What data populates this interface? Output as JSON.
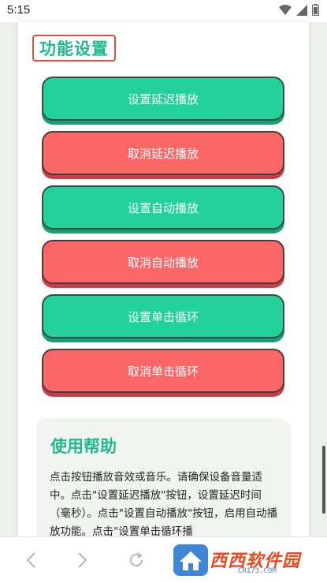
{
  "status_bar": {
    "time": "5:15",
    "icons": [
      "wifi-icon",
      "signal-icon",
      "battery-icon"
    ]
  },
  "settings": {
    "title": "功能设置",
    "buttons": [
      {
        "label": "设置延迟播放",
        "color": "#22d29a"
      },
      {
        "label": "取消延迟播放",
        "color": "#fb6767"
      },
      {
        "label": "设置自动播放",
        "color": "#22d29a"
      },
      {
        "label": "取消自动播放",
        "color": "#fb6767"
      },
      {
        "label": "设置单击循环",
        "color": "#22d29a"
      },
      {
        "label": "取消单击循环",
        "color": "#fb6767"
      }
    ]
  },
  "help": {
    "title": "使用帮助",
    "text": "点击按钮播放音效或音乐。请确保设备音量适中。点击\"设置延迟播放\"按钮，设置延迟时间（毫秒）。点击\"设置自动播放\"按钮，启用自动播放功能。点击\"设置单击循环播"
  },
  "nav": {
    "icons": [
      "back-icon",
      "forward-icon",
      "refresh-icon"
    ]
  },
  "watermark": {
    "text": "西西软件园",
    "sub": "CR173.COM"
  },
  "colors": {
    "accent": "#1fb98a",
    "green": "#22d29a",
    "red": "#fb6767"
  }
}
